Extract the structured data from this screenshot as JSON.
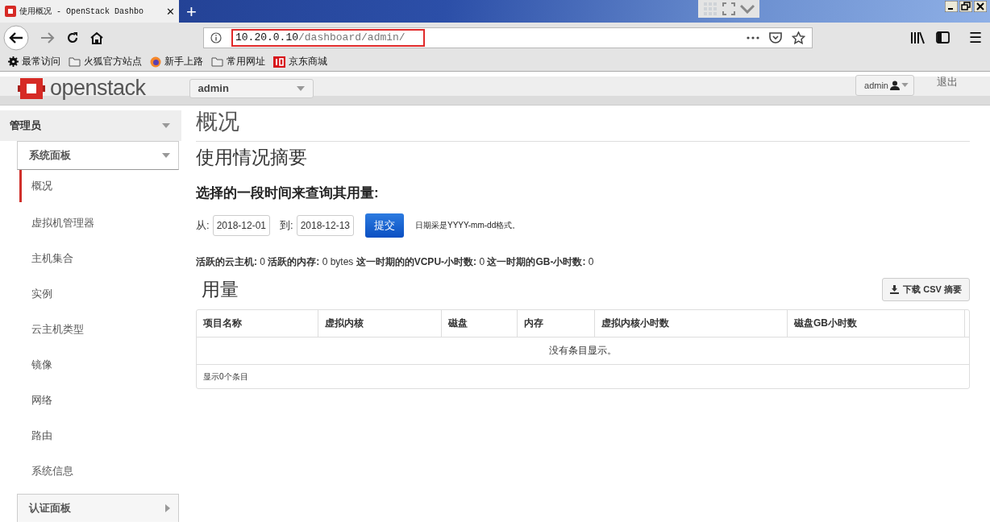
{
  "browser": {
    "tab": {
      "title": "使用概况 - OpenStack Dashbo",
      "close": "✕"
    },
    "new_tab": "+",
    "url_host": "10.20.0.10",
    "url_path": "/dashboard/admin/",
    "url_highlighted": true,
    "menu": "☰",
    "bookmarks": [
      {
        "kind": "gear",
        "label": "最常访问"
      },
      {
        "kind": "folder",
        "label": "火狐官方站点"
      },
      {
        "kind": "firefox",
        "label": "新手上路"
      },
      {
        "kind": "folder",
        "label": "常用网址"
      },
      {
        "kind": "jd",
        "label": "京东商城"
      }
    ]
  },
  "header": {
    "logo": "openstack",
    "project": "admin",
    "user": "admin",
    "logout": "退出"
  },
  "sidebar": {
    "section": {
      "label": "管理员",
      "expanded": true
    },
    "panel": {
      "label": "系统面板",
      "expanded": true
    },
    "items": [
      {
        "label": "概况",
        "selected": true
      },
      {
        "label": "虚拟机管理器",
        "selected": false
      },
      {
        "label": "主机集合",
        "selected": false
      },
      {
        "label": "实例",
        "selected": false
      },
      {
        "label": "云主机类型",
        "selected": false
      },
      {
        "label": "镜像",
        "selected": false
      },
      {
        "label": "网络",
        "selected": false
      },
      {
        "label": "路由",
        "selected": false
      },
      {
        "label": "系统信息",
        "selected": false
      }
    ],
    "next_panel": {
      "label": "认证面板",
      "expanded": false
    }
  },
  "main": {
    "title": "概况",
    "subtitle": "使用情况摘要",
    "query_heading": "选择的一段时间来查询其用量:",
    "from_label": "从:",
    "from": "2018-12-01",
    "to_label": "到:",
    "to": "2018-12-13",
    "submit": "提交",
    "date_hint": "日期采是YYYY-mm-dd格式。",
    "stats": "**活跃的云主机:** 0 **活跃的内存:** 0 bytes **这一时期的的VCPU-小时数:** 0 **这一时期的GB-小时数:** 0",
    "usage_title": "用量",
    "download": "下载 CSV 摘要",
    "table": {
      "columns": [
        "项目名称",
        "虚拟内核",
        "磁盘",
        "内存",
        "虚拟内核小时数",
        "磁盘GB小时数"
      ],
      "empty": "没有条目显示。",
      "footer": "显示0个条目"
    }
  }
}
